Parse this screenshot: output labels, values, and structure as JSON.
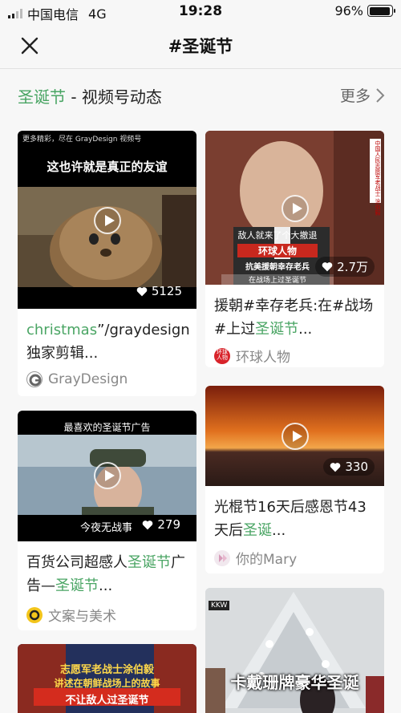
{
  "status_bar": {
    "carrier": "中国电信",
    "network": "4G",
    "time": "19:28",
    "battery": "96%",
    "battery_level": 0.96
  },
  "nav": {
    "title": "#圣诞节"
  },
  "section": {
    "title_highlight": "圣诞节",
    "title_rest": " - 视频号动态",
    "more": "更多"
  },
  "cards": [
    {
      "overlay_top": "更多精彩，尽在 GrayDesign 视频号",
      "overlay_main": "这也许就是真正的友谊",
      "likes": "5125",
      "title_parts": [
        "christmas",
        "”/graydesign独家剪辑..."
      ],
      "author": "GrayDesign"
    },
    {
      "likes": "2.7万",
      "overlay_lines": [
        "敌人就来了个大撤退",
        "环球人物",
        "抗美援朝幸存老兵",
        "在战场上过圣诞节"
      ],
      "corner_tag": "中国人民志愿军老战士 涂伯毅",
      "title_parts": [
        "援朝#幸存老兵:在#战场#上过",
        "圣诞节",
        "..."
      ],
      "author": "环球人物",
      "author_badge": "环球人物"
    },
    {
      "overlay_main": "最喜欢的圣诞节广告",
      "subtitle": "今夜无战事",
      "likes": "279",
      "title_parts": [
        "百货公司超感人",
        "圣诞节",
        "广告—",
        "圣诞节",
        "..."
      ],
      "author": "文案与美术"
    },
    {
      "likes": "330",
      "title_parts": [
        "光棍节16天后感恩节43天后",
        "圣诞",
        "..."
      ],
      "author": "你的Mary"
    },
    {
      "overlay_lines": [
        "志愿军老战士涂伯毅",
        "讲述在朝鲜战场上的故事",
        "不让敌人过圣诞节"
      ]
    },
    {
      "overlay_main": "卡戴珊牌豪华圣诞",
      "corner_tag": "KKW"
    }
  ],
  "colors": {
    "accent": "#4aa564",
    "page_bg": "#f7f7f7"
  }
}
